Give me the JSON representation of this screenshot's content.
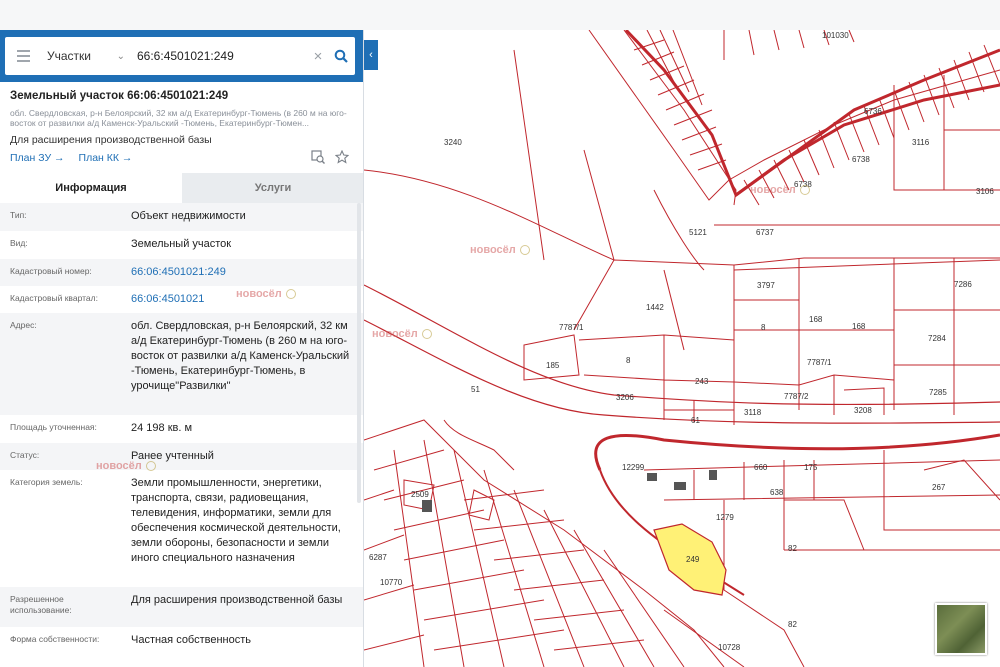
{
  "search": {
    "type_label": "Участки",
    "query": "66:6:4501021:249"
  },
  "parcel": {
    "title": "Земельный участок 66:06:4501021:249",
    "address_short": "обл. Свердловская, р-н Белоярский, 32 км а/д Екатеринбург-Тюмень (в 260 м на юго-восток от развилки а/д Каменск-Уральский -Тюмень, Екатеринбург-Тюмен...",
    "purpose": "Для расширения производственной базы",
    "links": [
      "План ЗУ →",
      "План КК →"
    ]
  },
  "tabs": [
    "Информация",
    "Услуги"
  ],
  "info_rows": [
    {
      "label": "Тип:",
      "value": "Объект недвижимости"
    },
    {
      "label": "Вид:",
      "value": "Земельный участок"
    },
    {
      "label": "Кадастровый номер:",
      "value": "66:06:4501021:249"
    },
    {
      "label": "Кадастровый квартал:",
      "value": "66:06:4501021"
    },
    {
      "label": "Адрес:",
      "value": "обл. Свердловская, р-н Белоярский, 32 км а/д Екатеринбург-Тюмень (в 260 м на юго-восток от развилки а/д Каменск-Уральский -Тюмень, Екатеринбург-Тюмень, в урочище\"Развилки\""
    },
    {
      "label": "Площадь уточненная:",
      "value": "24 198 кв. м"
    },
    {
      "label": "Статус:",
      "value": "Ранее учтенный"
    },
    {
      "label": "Категория земель:",
      "value": "Земли промышленности, энергетики, транспорта, связи, радиовещания, телевидения, информатики, земли для обеспечения космической деятельности, земли обороны, безопасности и земли иного специального назначения"
    },
    {
      "label": "Разрешенное использование:",
      "value": "Для расширения производственной базы"
    },
    {
      "label": "Форма собственности:",
      "value": "Частная собственность"
    }
  ],
  "watermark": {
    "brand": "новосёл"
  },
  "map": {
    "labels": [
      "101030",
      "3240",
      "6736",
      "6738",
      "3116",
      "6738",
      "3106",
      "6737",
      "5121",
      "1442",
      "3797",
      "7286",
      "8",
      "168",
      "168",
      "7284",
      "185",
      "8",
      "243",
      "7787/2",
      "7285",
      "3206",
      "3118",
      "61",
      "3208",
      "7787/1",
      "7787/1",
      "51",
      "12299",
      "660",
      "175",
      "638",
      "267",
      "1279",
      "249",
      "82",
      "82",
      "2509",
      "6287",
      "10770",
      "10728"
    ],
    "highlight_parcel": "249",
    "colors": {
      "boundary": "#c0272d",
      "highlight": "#fff176"
    }
  },
  "colors": {
    "accent": "#1f6fb5",
    "boundary": "#c0272d"
  }
}
